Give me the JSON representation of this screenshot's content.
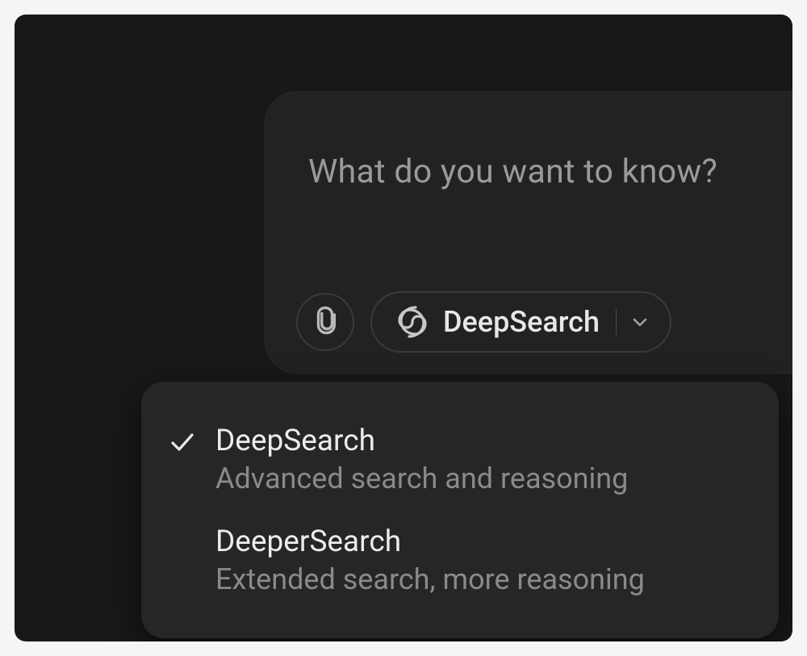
{
  "composer": {
    "placeholder": "What do you want to know?",
    "mode_label": "DeepSearch"
  },
  "dropdown": {
    "items": [
      {
        "title": "DeepSearch",
        "description": "Advanced search and reasoning",
        "selected": true
      },
      {
        "title": "DeeperSearch",
        "description": "Extended search, more reasoning",
        "selected": false
      }
    ]
  }
}
